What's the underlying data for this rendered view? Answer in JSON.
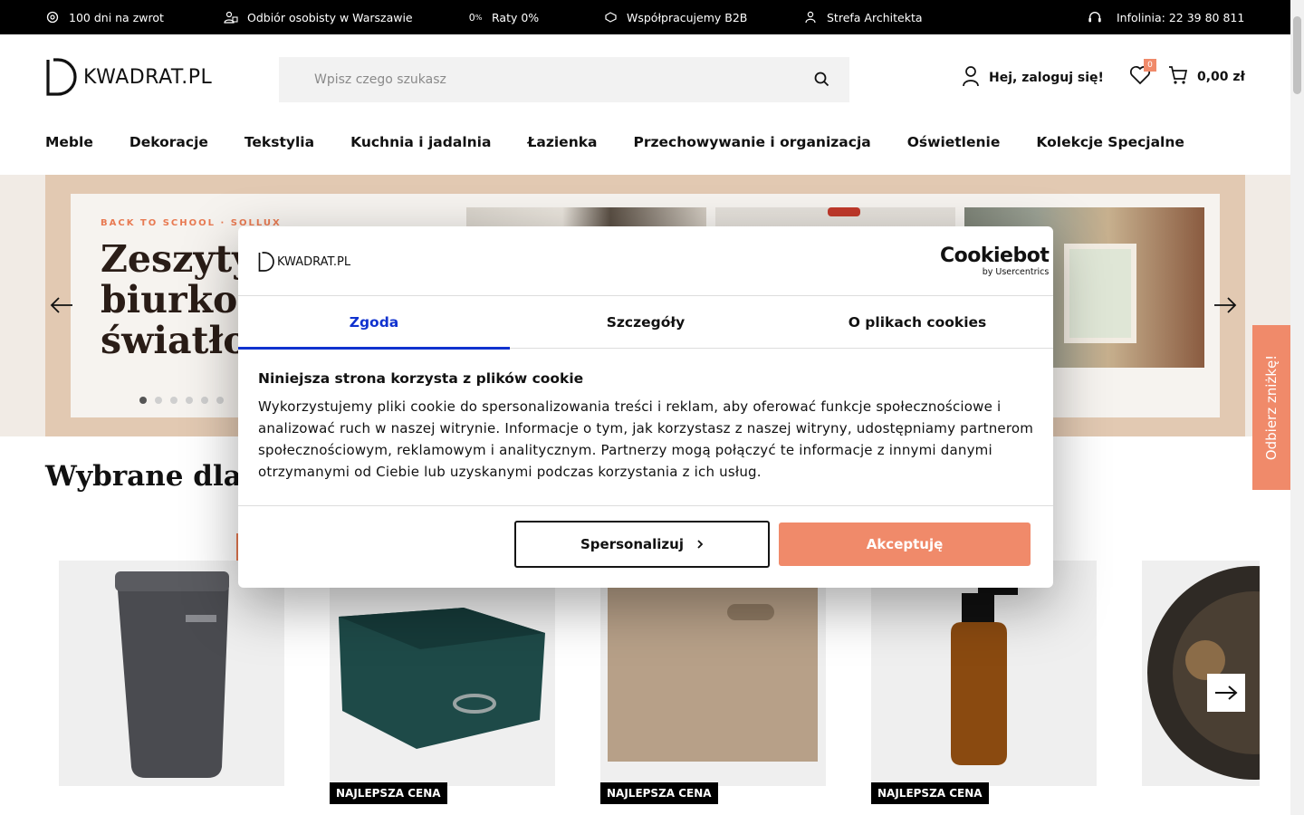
{
  "topbar": {
    "items": [
      {
        "label": "100 dni na zwrot",
        "icon": "return-icon"
      },
      {
        "label": "Odbiór osobisty w Warszawie",
        "icon": "pickup-icon"
      },
      {
        "label": "Raty 0%",
        "icon": "percent-icon"
      },
      {
        "label": "Współpracujemy B2B",
        "icon": "handshake-icon"
      },
      {
        "label": "Strefa Architekta",
        "icon": "person-icon"
      }
    ],
    "hotline": "Infolinia: 22 39 80 811"
  },
  "header": {
    "logo_text": "KWADRAT.PL",
    "search_placeholder": "Wpisz czego szukasz",
    "account_label": "Hej, zaloguj się!",
    "wishlist_count": "0",
    "cart_total": "0,00 zł"
  },
  "nav": {
    "items": [
      "Meble",
      "Dekoracje",
      "Tekstylia",
      "Kuchnia i jadalnia",
      "Łazienka",
      "Przechowywanie i organizacja",
      "Oświetlenie",
      "Kolekcje Specjalne"
    ]
  },
  "hero": {
    "kicker": "BACK TO SCHOOL · SOLLUX",
    "title_line1": "Zeszyty",
    "title_line2": "biurko g",
    "title_line3": "światło?",
    "slide_count": 6,
    "active_slide": 0
  },
  "side_tab": {
    "label": "Odbierz zniżkę!"
  },
  "section": {
    "title": "Wybrane dla C"
  },
  "products": {
    "badge_label": "NAJLEPSZA CENA",
    "items": [
      {
        "name": "laundry-basket",
        "badge": false
      },
      {
        "name": "fabric-storage-box",
        "badge": true
      },
      {
        "name": "wooden-storage-box",
        "badge": true
      },
      {
        "name": "soap-dispenser",
        "badge": true
      },
      {
        "name": "wall-clock",
        "badge": false
      }
    ]
  },
  "cookie_modal": {
    "logo_text": "KWADRAT.PL",
    "provider": "Cookiebot",
    "provider_sub": "by Usercentrics",
    "tabs": [
      "Zgoda",
      "Szczegóły",
      "O plikach cookies"
    ],
    "active_tab": 0,
    "heading": "Niniejsza strona korzysta z plików cookie",
    "body": "Wykorzystujemy pliki cookie do spersonalizowania treści i reklam, aby oferować funkcje społecznościowe i analizować ruch w naszej witrynie. Informacje o tym, jak korzystasz z naszej witryny, udostępniamy partnerom społecznościowym, reklamowym i analitycznym. Partnerzy mogą połączyć te informacje z innymi danymi otrzymanymi od Ciebie lub uzyskanymi podczas korzystania z ich usług.",
    "btn_customize": "Spersonalizuj",
    "btn_accept": "Akceptuję"
  },
  "colors": {
    "accent": "#f08a6a",
    "tab_active": "#1032cf",
    "hero_frame": "#e2c9b2",
    "topbar": "#000000"
  }
}
